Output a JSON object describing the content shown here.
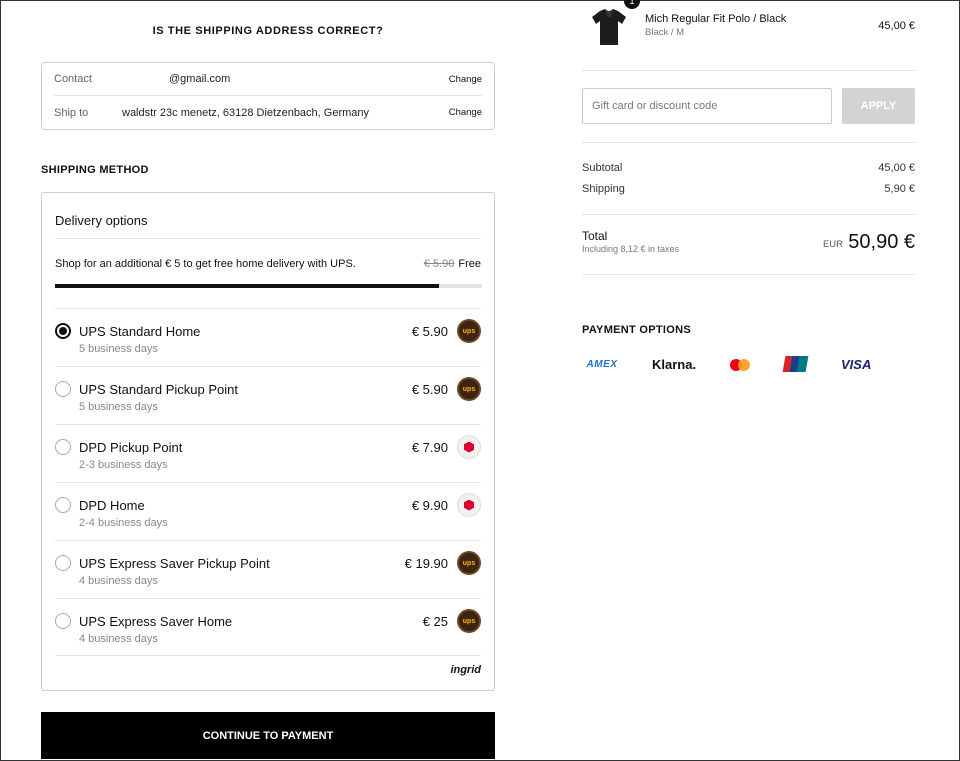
{
  "address": {
    "title": "IS THE SHIPPING ADDRESS CORRECT?",
    "contact_label": "Contact",
    "contact_value": "@gmail.com",
    "ship_to_label": "Ship to",
    "ship_to_value": "waldstr 23c menetz, 63128 Dietzenbach, Germany",
    "change_label": "Change"
  },
  "shipping": {
    "title": "SHIPPING METHOD",
    "delivery_title": "Delivery options",
    "promo_text": "Shop for an additional € 5 to get free home delivery with UPS.",
    "promo_old_price": "€ 5.90",
    "promo_new_price": "Free",
    "progress_fraction": 0.9,
    "options": [
      {
        "name": "UPS Standard Home",
        "days": "5 business days",
        "price": "€ 5.90",
        "carrier": "ups-icon",
        "selected": true
      },
      {
        "name": "UPS Standard Pickup Point",
        "days": "5 business days",
        "price": "€ 5.90",
        "carrier": "ups-icon",
        "selected": false
      },
      {
        "name": "DPD Pickup Point",
        "days": "2-3 business days",
        "price": "€ 7.90",
        "carrier": "dpd-icon",
        "selected": false
      },
      {
        "name": "DPD Home",
        "days": "2-4 business days",
        "price": "€ 9.90",
        "carrier": "dpd-icon",
        "selected": false
      },
      {
        "name": "UPS Express Saver Pickup Point",
        "days": "4 business days",
        "price": "€ 19.90",
        "carrier": "ups-icon",
        "selected": false
      },
      {
        "name": "UPS Express Saver Home",
        "days": "4 business days",
        "price": "€ 25",
        "carrier": "ups-icon",
        "selected": false
      }
    ],
    "powered_by": "ingrid",
    "ups_logo_text": "ups"
  },
  "continue_label": "CONTINUE TO PAYMENT",
  "order": {
    "product_name": "Mich Regular Fit Polo / Black",
    "product_variant": "Black / M",
    "product_price": "45,00 €",
    "quantity": "1",
    "discount_placeholder": "Gift card or discount code",
    "apply_label": "APPLY",
    "subtotal_label": "Subtotal",
    "subtotal_value": "45,00 €",
    "shipping_label": "Shipping",
    "shipping_value": "5,90 €",
    "total_label": "Total",
    "total_tax": "Including 8,12 € in taxes",
    "total_currency": "EUR",
    "total_value": "50,90 €"
  },
  "payment": {
    "title": "PAYMENT OPTIONS",
    "amex": "AMEX",
    "klarna": "Klarna.",
    "visa": "VISA"
  },
  "colors": {
    "accent": "#000000",
    "apply_disabled": "#d3d3d3",
    "ups_brown": "#3d2412",
    "dpd_red": "#dc0032"
  }
}
